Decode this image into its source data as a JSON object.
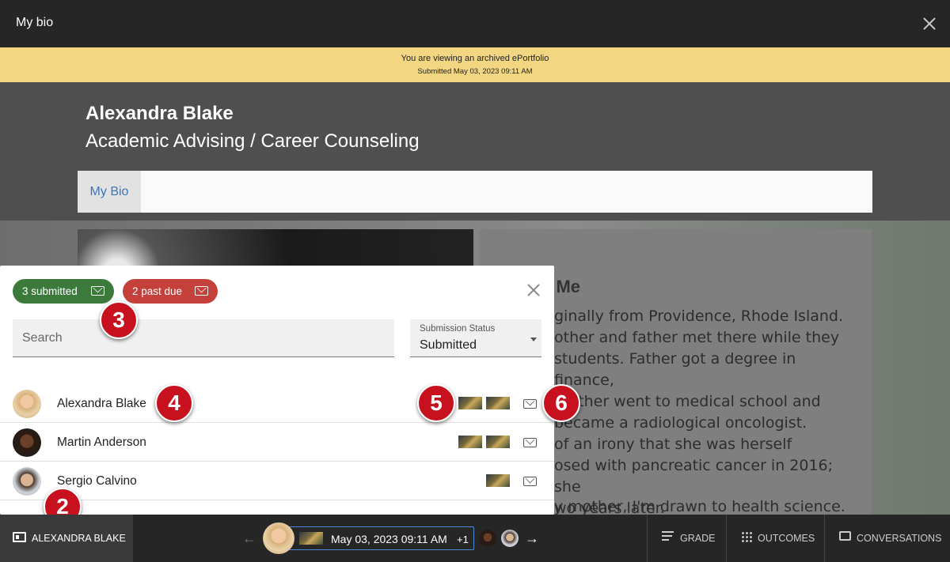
{
  "window": {
    "title": "My bio"
  },
  "banner": {
    "line1": "You are viewing an archived ePortfolio",
    "line2": "Submitted May 03, 2023 09:11 AM"
  },
  "portfolio": {
    "name": "Alexandra Blake",
    "department": "Academic Advising / Career Counseling",
    "nav_tab": "My Bio",
    "about_heading": "t Me",
    "about_text": "ginally from Providence, Rhode Island.\nother and father met there while they\nstudents. Father got a degree in finance,\nmother went to medical school and\n became a radiological oncologist.\n of an irony that she was herself\nosed with pancreatic cancer in 2016; she\nwo years later.",
    "about_text2": "y mother, I'm drawn to health science."
  },
  "popup": {
    "submitted_label": "3 submitted",
    "past_due_label": "2 past due",
    "search_placeholder": "Search",
    "status_label": "Submission Status",
    "status_value": "Submitted",
    "students": [
      {
        "name": "Alexandra Blake",
        "avatar": "avatar-blonde"
      },
      {
        "name": "Martin Anderson",
        "avatar": "avatar-dark"
      },
      {
        "name": "Sergio Calvino",
        "avatar": "avatar-man"
      }
    ]
  },
  "callouts": [
    "2",
    "3",
    "4",
    "5",
    "6"
  ],
  "bottombar": {
    "student_label": "ALEXANDRA BLAKE",
    "submission_date": "May 03, 2023 09:11 AM",
    "more_count": "+1",
    "grade_label": "GRADE",
    "outcomes_label": "OUTCOMES",
    "conversations_label": "CONVERSATIONS"
  },
  "colors": {
    "submitted": "#3c7a3c",
    "past_due": "#c4403a",
    "banner": "#f2d682",
    "callout": "#c8111e",
    "link": "#3a76b8"
  }
}
